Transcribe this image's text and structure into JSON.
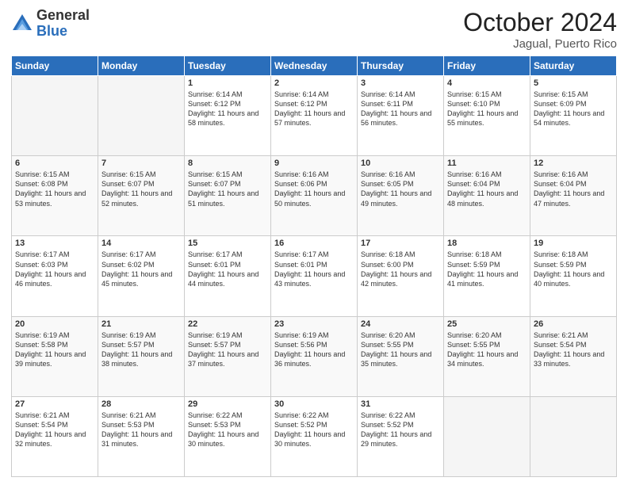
{
  "logo": {
    "general": "General",
    "blue": "Blue"
  },
  "header": {
    "month": "October 2024",
    "location": "Jagual, Puerto Rico"
  },
  "days_of_week": [
    "Sunday",
    "Monday",
    "Tuesday",
    "Wednesday",
    "Thursday",
    "Friday",
    "Saturday"
  ],
  "weeks": [
    [
      {
        "day": "",
        "content": ""
      },
      {
        "day": "",
        "content": ""
      },
      {
        "day": "1",
        "content": "Sunrise: 6:14 AM\nSunset: 6:12 PM\nDaylight: 11 hours and 58 minutes."
      },
      {
        "day": "2",
        "content": "Sunrise: 6:14 AM\nSunset: 6:12 PM\nDaylight: 11 hours and 57 minutes."
      },
      {
        "day": "3",
        "content": "Sunrise: 6:14 AM\nSunset: 6:11 PM\nDaylight: 11 hours and 56 minutes."
      },
      {
        "day": "4",
        "content": "Sunrise: 6:15 AM\nSunset: 6:10 PM\nDaylight: 11 hours and 55 minutes."
      },
      {
        "day": "5",
        "content": "Sunrise: 6:15 AM\nSunset: 6:09 PM\nDaylight: 11 hours and 54 minutes."
      }
    ],
    [
      {
        "day": "6",
        "content": "Sunrise: 6:15 AM\nSunset: 6:08 PM\nDaylight: 11 hours and 53 minutes."
      },
      {
        "day": "7",
        "content": "Sunrise: 6:15 AM\nSunset: 6:07 PM\nDaylight: 11 hours and 52 minutes."
      },
      {
        "day": "8",
        "content": "Sunrise: 6:15 AM\nSunset: 6:07 PM\nDaylight: 11 hours and 51 minutes."
      },
      {
        "day": "9",
        "content": "Sunrise: 6:16 AM\nSunset: 6:06 PM\nDaylight: 11 hours and 50 minutes."
      },
      {
        "day": "10",
        "content": "Sunrise: 6:16 AM\nSunset: 6:05 PM\nDaylight: 11 hours and 49 minutes."
      },
      {
        "day": "11",
        "content": "Sunrise: 6:16 AM\nSunset: 6:04 PM\nDaylight: 11 hours and 48 minutes."
      },
      {
        "day": "12",
        "content": "Sunrise: 6:16 AM\nSunset: 6:04 PM\nDaylight: 11 hours and 47 minutes."
      }
    ],
    [
      {
        "day": "13",
        "content": "Sunrise: 6:17 AM\nSunset: 6:03 PM\nDaylight: 11 hours and 46 minutes."
      },
      {
        "day": "14",
        "content": "Sunrise: 6:17 AM\nSunset: 6:02 PM\nDaylight: 11 hours and 45 minutes."
      },
      {
        "day": "15",
        "content": "Sunrise: 6:17 AM\nSunset: 6:01 PM\nDaylight: 11 hours and 44 minutes."
      },
      {
        "day": "16",
        "content": "Sunrise: 6:17 AM\nSunset: 6:01 PM\nDaylight: 11 hours and 43 minutes."
      },
      {
        "day": "17",
        "content": "Sunrise: 6:18 AM\nSunset: 6:00 PM\nDaylight: 11 hours and 42 minutes."
      },
      {
        "day": "18",
        "content": "Sunrise: 6:18 AM\nSunset: 5:59 PM\nDaylight: 11 hours and 41 minutes."
      },
      {
        "day": "19",
        "content": "Sunrise: 6:18 AM\nSunset: 5:59 PM\nDaylight: 11 hours and 40 minutes."
      }
    ],
    [
      {
        "day": "20",
        "content": "Sunrise: 6:19 AM\nSunset: 5:58 PM\nDaylight: 11 hours and 39 minutes."
      },
      {
        "day": "21",
        "content": "Sunrise: 6:19 AM\nSunset: 5:57 PM\nDaylight: 11 hours and 38 minutes."
      },
      {
        "day": "22",
        "content": "Sunrise: 6:19 AM\nSunset: 5:57 PM\nDaylight: 11 hours and 37 minutes."
      },
      {
        "day": "23",
        "content": "Sunrise: 6:19 AM\nSunset: 5:56 PM\nDaylight: 11 hours and 36 minutes."
      },
      {
        "day": "24",
        "content": "Sunrise: 6:20 AM\nSunset: 5:55 PM\nDaylight: 11 hours and 35 minutes."
      },
      {
        "day": "25",
        "content": "Sunrise: 6:20 AM\nSunset: 5:55 PM\nDaylight: 11 hours and 34 minutes."
      },
      {
        "day": "26",
        "content": "Sunrise: 6:21 AM\nSunset: 5:54 PM\nDaylight: 11 hours and 33 minutes."
      }
    ],
    [
      {
        "day": "27",
        "content": "Sunrise: 6:21 AM\nSunset: 5:54 PM\nDaylight: 11 hours and 32 minutes."
      },
      {
        "day": "28",
        "content": "Sunrise: 6:21 AM\nSunset: 5:53 PM\nDaylight: 11 hours and 31 minutes."
      },
      {
        "day": "29",
        "content": "Sunrise: 6:22 AM\nSunset: 5:53 PM\nDaylight: 11 hours and 30 minutes."
      },
      {
        "day": "30",
        "content": "Sunrise: 6:22 AM\nSunset: 5:52 PM\nDaylight: 11 hours and 30 minutes."
      },
      {
        "day": "31",
        "content": "Sunrise: 6:22 AM\nSunset: 5:52 PM\nDaylight: 11 hours and 29 minutes."
      },
      {
        "day": "",
        "content": ""
      },
      {
        "day": "",
        "content": ""
      }
    ]
  ]
}
